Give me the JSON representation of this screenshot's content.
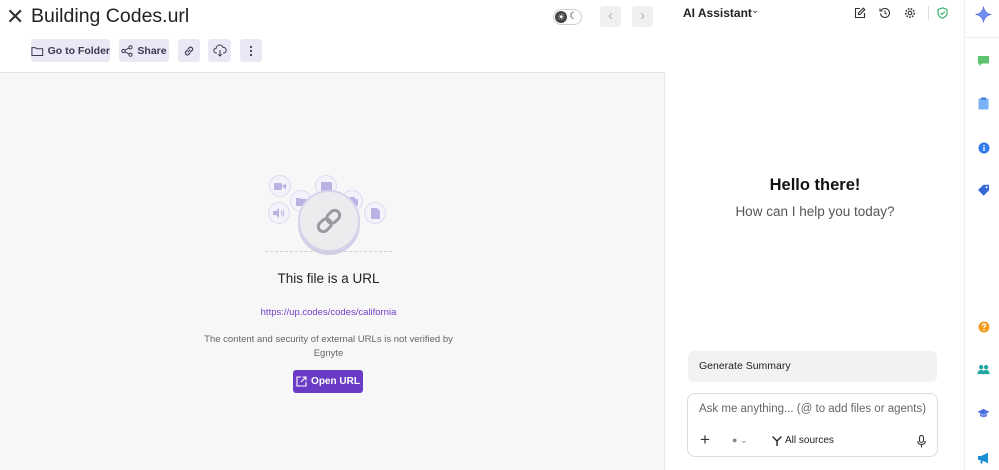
{
  "file": {
    "title": "Building Codes.url"
  },
  "toolbar": {
    "go_to_folder": "Go to Folder",
    "share": "Share"
  },
  "preview": {
    "heading": "This file is a URL",
    "url": "https://up.codes/codes/california",
    "note": "The content and security of external URLs is not verified by Egnyte",
    "open_url": "Open URL"
  },
  "assistant": {
    "title": "AI Assistant",
    "greeting": "Hello there!",
    "subgreeting": "How can I help you today?",
    "suggestion": "Generate Summary",
    "input_placeholder": "Ask me anything... (@ to add files or agents)",
    "sources_label": "All sources"
  },
  "colors": {
    "accent": "#6a3bc4",
    "link": "#6e40c9",
    "toolbar_button_bg": "#ebe8f5",
    "status_green": "#2eaa5c"
  },
  "icons": {
    "close": "close-icon",
    "folder": "folder-icon",
    "share": "share-icon",
    "link": "link-icon",
    "cloud_download": "cloud-download-icon",
    "more": "more-vertical-icon",
    "external": "external-link-icon",
    "edit": "edit-icon",
    "history": "history-icon",
    "settings": "gear-icon",
    "shield": "shield-check-icon",
    "sparkle": "sparkle-icon"
  }
}
